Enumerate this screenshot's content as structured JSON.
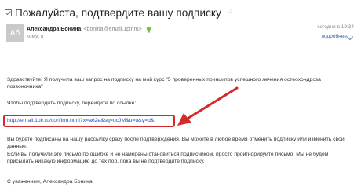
{
  "email": {
    "subject": "Пожалуйста, подтвердите вашу подписку",
    "sender": {
      "avatar_initials": "Аб",
      "name": "Александра Бонина",
      "email": "<bonina@email.1pir.ru>",
      "to": "кому: я"
    },
    "date": "сегодня в 19:34",
    "details_label": "подробнее",
    "body": {
      "greeting": "Здравствуйте! Я получила ваш запрос на подписку на мой курс \"5 проверенных принципов успешного лечения остеохондроза позвоночника\"",
      "instruction": "Чтобы подтвердить подписку, перейдите по ссылке:",
      "confirm_link": "http://email.1pir.ru/confirm.html?x=a62e&sq=ucJM&u=u&y=d&",
      "info1": "Вы будете подписаны на нашу рассылку сразу после подтверждения. Вы можете в любое время отменить подписку или изменить свои данные.",
      "info2": "Если вы получили это письмо по ошибке и не намерены становиться подписчиком, просто проигнорируйте письмо. Мы не будем присылать никакую информацию до тех пор, пока вы не подтвердите подписку.",
      "signature": "С уважением, Александра Бонина"
    }
  },
  "colors": {
    "highlight": "#d42a2a",
    "link": "#2255bb",
    "avatar_bg": "#c9c9c9"
  }
}
